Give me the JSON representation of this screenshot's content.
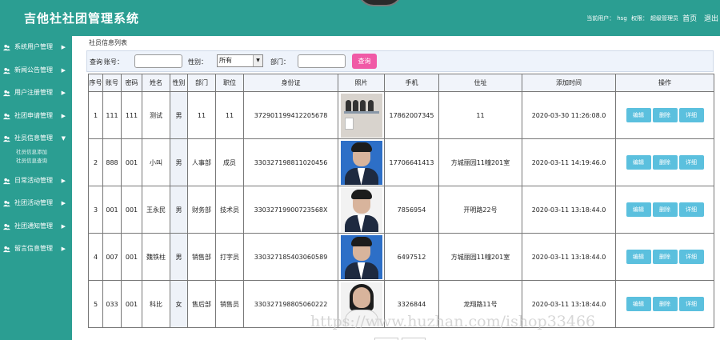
{
  "header": {
    "title": "吉他社社团管理系统",
    "current_user_label": "当前用户：",
    "current_user": "hsg",
    "role_label": "权限：",
    "role": "超级管理员",
    "nav_home": "首页",
    "nav_logout": "退出"
  },
  "sidebar": {
    "items": [
      {
        "label": "系统用户管理",
        "icon": "user-group-icon"
      },
      {
        "label": "新闻公告管理",
        "icon": "user-group-icon"
      },
      {
        "label": "用户注册管理",
        "icon": "user-group-icon"
      },
      {
        "label": "社团申请管理",
        "icon": "user-group-icon"
      },
      {
        "label": "社员信息管理",
        "icon": "user-group-icon",
        "expanded": true,
        "children": [
          "社员信息添加",
          "社员信息查询"
        ]
      },
      {
        "label": "日常活动管理",
        "icon": "user-group-icon"
      },
      {
        "label": "社团活动管理",
        "icon": "user-group-icon"
      },
      {
        "label": "社团通知管理",
        "icon": "user-group-icon"
      },
      {
        "label": "留言信息管理",
        "icon": "user-group-icon"
      }
    ]
  },
  "breadcrumb": "社员信息列表",
  "search": {
    "query_label": "查询",
    "account_label": "账号：",
    "account_value": "",
    "gender_label": "性别：",
    "gender_selected": "所有",
    "department_label": "部门：",
    "department_value": "",
    "button_label": "查询"
  },
  "table": {
    "columns": [
      "序号",
      "账号",
      "密码",
      "姓名",
      "性别",
      "部门",
      "职位",
      "身份证",
      "照片",
      "手机",
      "住址",
      "添加时间",
      "操作"
    ],
    "rows": [
      {
        "no": "1",
        "account": "111",
        "password": "111",
        "name": "测试",
        "gender": "男",
        "dept": "11",
        "position": "11",
        "id_card": "372901199412205678",
        "photo": "group-photo",
        "phone": "17862007345",
        "address": "11",
        "added": "2020-03-30 11:26:08.0",
        "actions": [
          "编辑",
          "删除",
          "详细"
        ]
      },
      {
        "no": "2",
        "account": "888",
        "password": "001",
        "name": "小叫",
        "gender": "男",
        "dept": "人事部",
        "position": "成员",
        "id_card": "330327198811020456",
        "photo": "male-portrait",
        "phone": "17706641413",
        "address": "方城丽园11幢201室",
        "added": "2020-03-11 14:19:46.0",
        "actions": [
          "编辑",
          "删除",
          "详细"
        ]
      },
      {
        "no": "3",
        "account": "001",
        "password": "001",
        "name": "王永民",
        "gender": "男",
        "dept": "财务部",
        "position": "技术员",
        "id_card": "33032719900723568X",
        "photo": "male-portrait",
        "phone": "7856954",
        "address": "开明路22号",
        "added": "2020-03-11 13:18:44.0",
        "actions": [
          "编辑",
          "删除",
          "详细"
        ]
      },
      {
        "no": "4",
        "account": "007",
        "password": "001",
        "name": "魏铁柱",
        "gender": "男",
        "dept": "销售部",
        "position": "打字员",
        "id_card": "330327185403060589",
        "photo": "male-portrait",
        "phone": "6497512",
        "address": "方城丽园11幢201室",
        "added": "2020-03-11 13:18:44.0",
        "actions": [
          "编辑",
          "删除",
          "详细"
        ]
      },
      {
        "no": "5",
        "account": "033",
        "password": "001",
        "name": "科比",
        "gender": "女",
        "dept": "售后部",
        "position": "销售员",
        "id_card": "330327198805060222",
        "photo": "female-portrait",
        "phone": "3326844",
        "address": "龙翔路11号",
        "added": "2020-03-11 13:18:44.0",
        "actions": [
          "编辑",
          "删除",
          "详细"
        ]
      }
    ]
  },
  "watermark": "https://www.huzhan.com/ishop33466",
  "colors": {
    "theme": "#2b9e92",
    "search_button": "#f05aa6",
    "action_button": "#5bc0de"
  }
}
